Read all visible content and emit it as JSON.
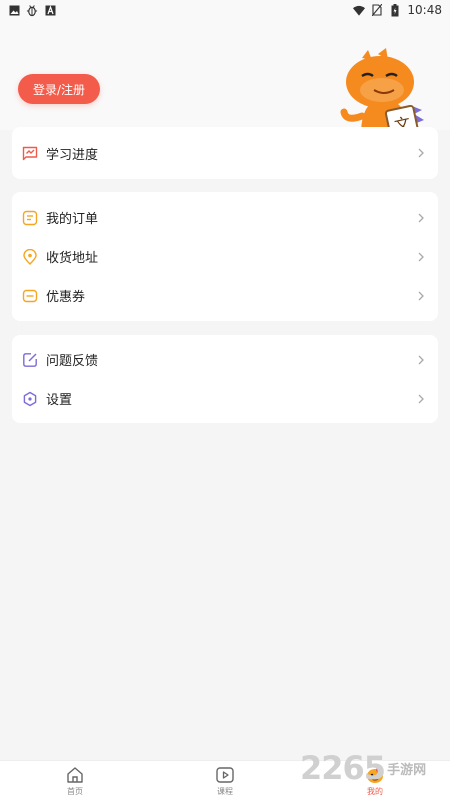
{
  "status_bar": {
    "time": "10:48",
    "left_icons": [
      "image-icon",
      "bug-icon",
      "text-a-icon"
    ],
    "right_icons": [
      "wifi-icon",
      "no-sim-icon",
      "battery-icon"
    ]
  },
  "header": {
    "login_label": "登录/注册",
    "mascot": "dinosaur-mascot-holding-文-card",
    "mascot_card_char": "文"
  },
  "groups": [
    {
      "items": [
        {
          "label": "学习进度",
          "icon": "progress-chart-icon"
        }
      ]
    },
    {
      "items": [
        {
          "label": "我的订单",
          "icon": "order-list-icon"
        },
        {
          "label": "收货地址",
          "icon": "location-pin-icon"
        },
        {
          "label": "优惠券",
          "icon": "coupon-icon"
        }
      ]
    },
    {
      "items": [
        {
          "label": "问题反馈",
          "icon": "feedback-edit-icon"
        },
        {
          "label": "设置",
          "icon": "settings-icon"
        }
      ]
    }
  ],
  "tabs": [
    {
      "label": "首页",
      "icon": "home-icon"
    },
    {
      "label": "课程",
      "icon": "play-video-icon"
    },
    {
      "label": "我的",
      "icon": "profile-mascot-icon",
      "active": true
    }
  ],
  "watermark": {
    "number": "2265",
    "text": "手游网"
  },
  "colors": {
    "accent": "#f35b4a",
    "icon_red": "#f05a4a",
    "icon_orange": "#f5a623",
    "icon_purple": "#7b6cd9"
  }
}
